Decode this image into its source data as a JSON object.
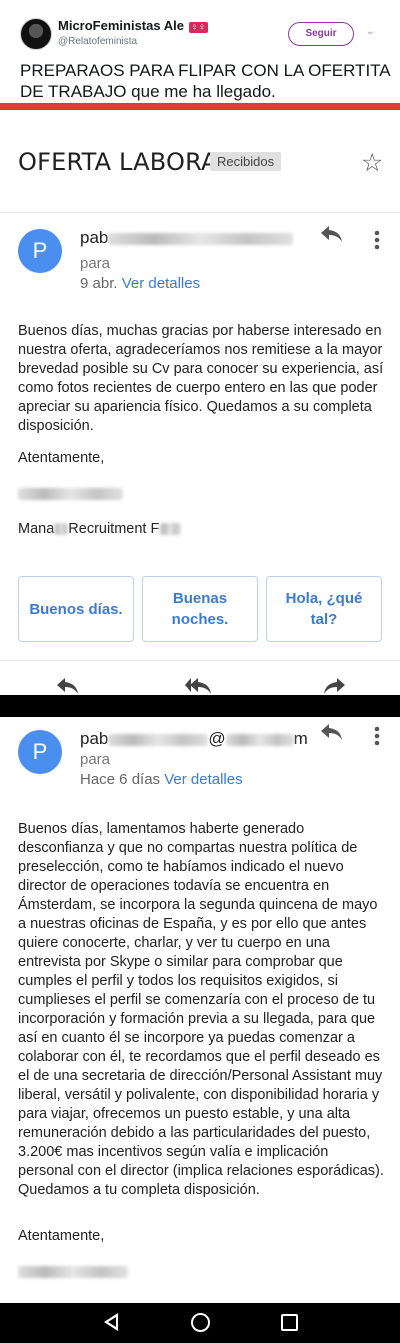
{
  "tweet": {
    "name": "MicroFeministas Ale",
    "name_emoji": "♀♀",
    "handle": "@Relatofeminista",
    "follow_label": "Seguir",
    "chevron": "⌄",
    "text": "PREPARAOS PARA FLIPAR CON LA OFERTITA DE TRABAJO que me ha llegado.",
    "accent": "#e23a2f"
  },
  "email": {
    "subject": "OFERTA LABORAL.",
    "label_badge": "Recibidos",
    "star_icon": "☆",
    "message1": {
      "avatar_letter": "P",
      "sender_prefix": "pab",
      "to_label": "para",
      "date": "9 abr.",
      "details_link": "Ver detalles",
      "body": "Buenos días, muchas gracias por haberse interesado en nuestra oferta, agradeceríamos nos remitiese a la mayor brevedad posible su Cv para conocer su experiencia, así como fotos recientes de cuerpo entero en las que poder apreciar su apariencia físico. Quedamos a su completa disposición.",
      "closing": "Atentamente,",
      "signature_role_prefix": "Mana",
      "signature_role_visible": "Recruitment F"
    },
    "smart_replies": [
      "Buenos días.",
      "Buenas noches.",
      "Hola, ¿qué tal?"
    ],
    "message2": {
      "avatar_letter": "P",
      "sender_prefix": "pab",
      "sender_suffix": "@",
      "sender_end": "m",
      "to_label": "para",
      "date": "Hace 6 días",
      "details_link": "Ver detalles",
      "body": "Buenos días, lamentamos haberte generado desconfianza y que no compartas nuestra política de preselección, como te habíamos indicado el nuevo director de operaciones todavía se encuentra en Ámsterdam, se incorpora la segunda quincena de mayo a nuestras oficinas de España, y es por ello que antes quiere conocerte, charlar, y ver tu cuerpo en una entrevista por Skype o similar para comprobar que cumples el perfil y todos los requisitos exigidos, si cumplieses el perfil se comenzaría con el proceso de tu incorporación y formación previa a su llegada, para que así en cuanto él se incorpore ya puedas comenzar a colaborar con él, te recordamos que el perfil deseado es el de una secretaria de dirección/Personal Assistant muy liberal, versátil y polivalente, con disponibilidad horaria y para viajar, ofrecemos un puesto estable, y una alta remuneración debido a las particularidades del puesto, 3.200€ mas incentivos según valía e implicación personal con el director (implica relaciones esporádicas). Quedamos a tu completa disposición.",
      "closing": "Atentamente,"
    }
  }
}
